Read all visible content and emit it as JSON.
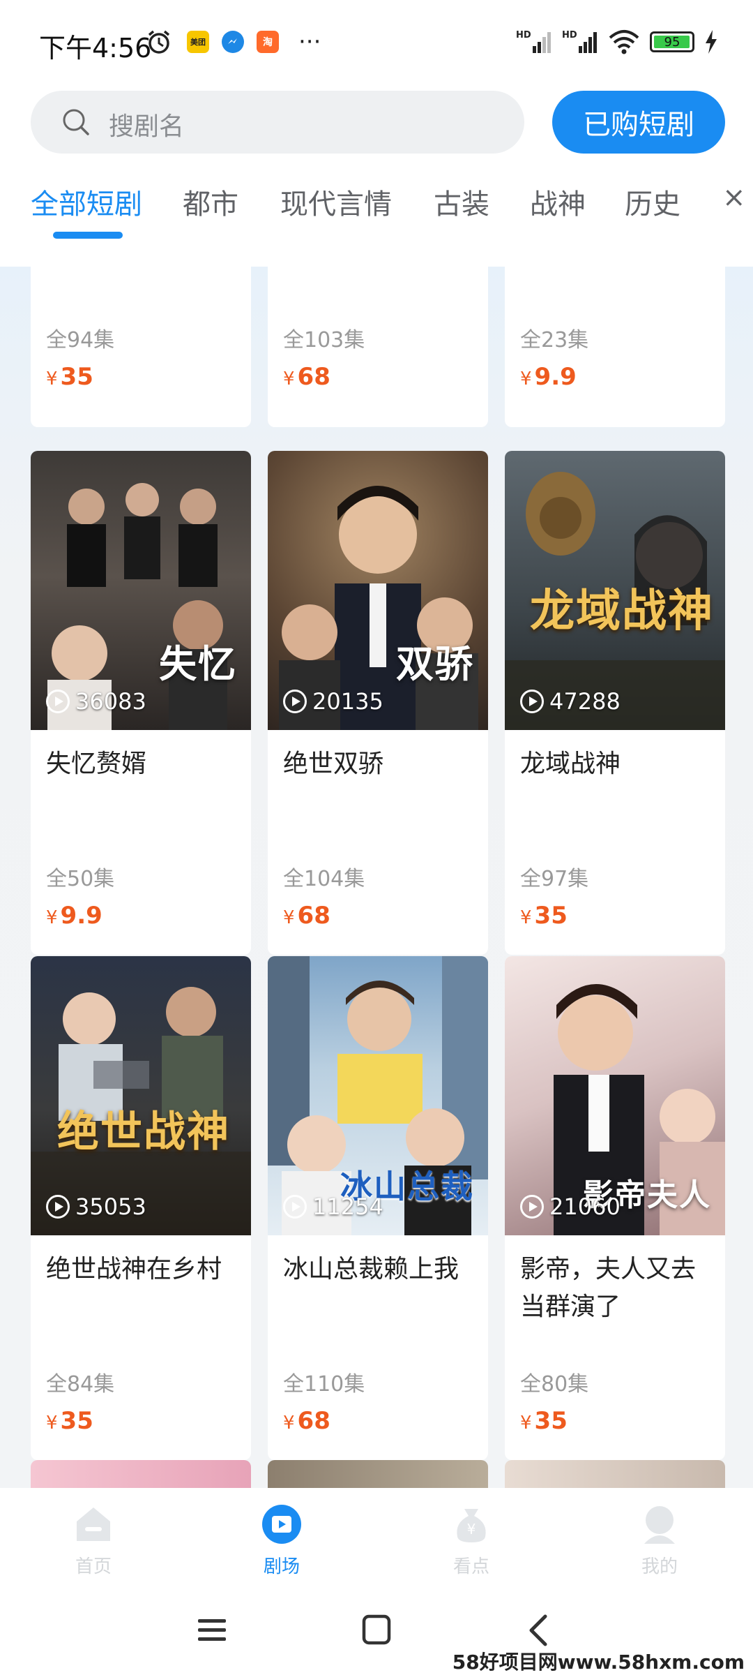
{
  "status_bar": {
    "time": "下午4:56",
    "mini_apps": [
      {
        "label": "美团",
        "color": "#f7c600"
      },
      {
        "label": "",
        "color": "#1e88e5"
      },
      {
        "label": "淘",
        "color": "#ff6a2b"
      }
    ],
    "more": "···",
    "signal_1": "HD",
    "signal_2": "HD",
    "battery": "95",
    "battery_level": 0.95
  },
  "header": {
    "search_placeholder": "搜剧名",
    "purchased_button": "已购短剧"
  },
  "tabs": [
    {
      "label": "全部短剧",
      "active": true
    },
    {
      "label": "都市",
      "active": false
    },
    {
      "label": "现代言情",
      "active": false
    },
    {
      "label": "古装",
      "active": false
    },
    {
      "label": "战神",
      "active": false
    },
    {
      "label": "历史",
      "active": false
    },
    {
      "label": "×",
      "active": false
    }
  ],
  "partial_row": [
    {
      "episodes": "全94集",
      "price": "35"
    },
    {
      "episodes": "全103集",
      "price": "68"
    },
    {
      "episodes": "全23集",
      "price": "9.9"
    }
  ],
  "cards": [
    {
      "title": "失忆赘婿",
      "poster_text": "失忆",
      "plays": "36083",
      "episodes": "全50集",
      "price": "9.9"
    },
    {
      "title": "绝世双骄",
      "poster_text": "双骄",
      "plays": "20135",
      "episodes": "全104集",
      "price": "68"
    },
    {
      "title": "龙域战神",
      "poster_text": "龙域战神",
      "plays": "47288",
      "episodes": "全97集",
      "price": "35"
    },
    {
      "title": "绝世战神在乡村",
      "poster_text": "绝世战神",
      "plays": "35053",
      "episodes": "全84集",
      "price": "35"
    },
    {
      "title": "冰山总裁赖上我",
      "poster_text": "冰山总裁",
      "plays": "11254",
      "episodes": "全110集",
      "price": "68"
    },
    {
      "title": "影帝，夫人又去当群演了",
      "poster_text": "影帝夫人",
      "plays": "21060",
      "episodes": "全80集",
      "price": "35"
    }
  ],
  "currency": "¥",
  "bottom_nav": [
    {
      "label": "首页",
      "active": false
    },
    {
      "label": "剧场",
      "active": true
    },
    {
      "label": "看点",
      "active": false
    },
    {
      "label": "我的",
      "active": false
    }
  ],
  "watermark": "58好项目网www.58hxm.com",
  "colors": {
    "accent": "#1a8cf2",
    "price": "#ee5a1e"
  }
}
